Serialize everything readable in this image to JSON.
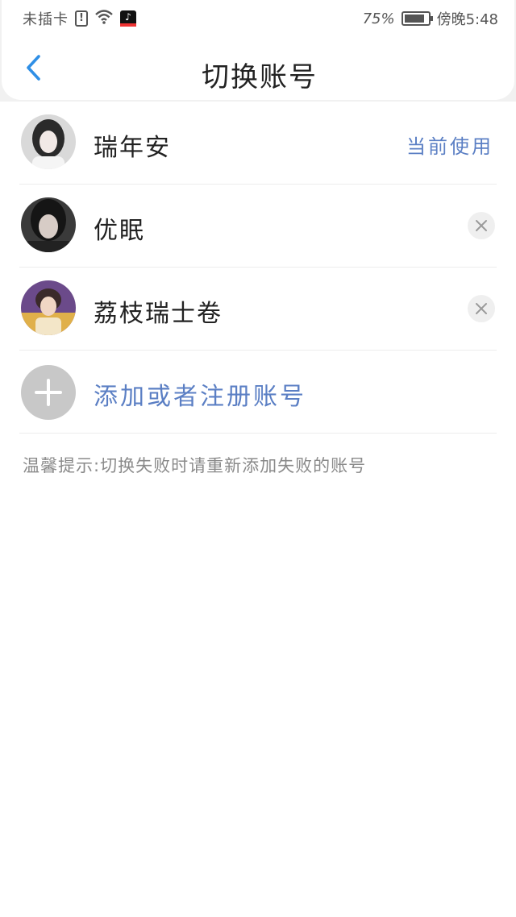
{
  "status_bar": {
    "sim_text": "未插卡",
    "battery_percent": "75%",
    "time": "傍晚5:48"
  },
  "nav": {
    "title": "切换账号"
  },
  "accounts": [
    {
      "name": "瑞年安",
      "status": "当前使用"
    },
    {
      "name": "优眠"
    },
    {
      "name": "荔枝瑞士卷"
    }
  ],
  "add_account": {
    "label": "添加或者注册账号"
  },
  "tip": "温馨提示:切换失败时请重新添加失败的账号",
  "colors": {
    "accent": "#5b7fc4",
    "back_arrow": "#2f8fe6"
  }
}
